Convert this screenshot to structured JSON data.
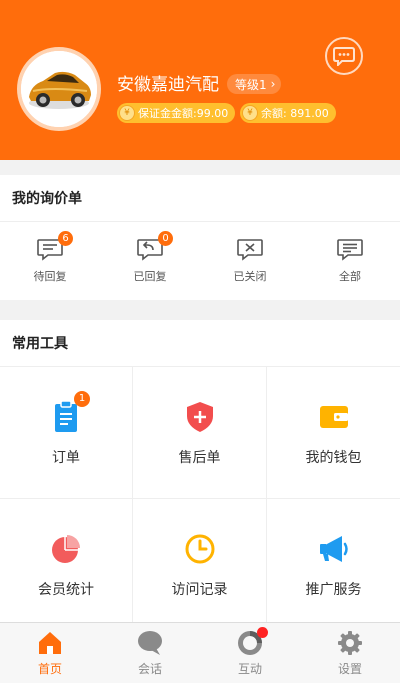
{
  "profile": {
    "shop_name": "安徽嘉迪汽配",
    "level_label": "等级1",
    "deposit_label": "保证金金额:99.00",
    "balance_label": "余额: 891.00",
    "coin_glyph": "¥"
  },
  "inquiry": {
    "title": "我的询价单",
    "items": [
      {
        "label": "待回复",
        "badge": "6"
      },
      {
        "label": "已回复",
        "badge": "0"
      },
      {
        "label": "已关闭"
      },
      {
        "label": "全部"
      }
    ]
  },
  "tools": {
    "title": "常用工具",
    "items": [
      {
        "label": "订单",
        "badge": "1",
        "icon": "clipboard-icon",
        "color": "#1e9bf0"
      },
      {
        "label": "售后单",
        "icon": "shield-plus-icon",
        "color": "#f24d4d"
      },
      {
        "label": "我的钱包",
        "icon": "wallet-icon",
        "color": "#ffb300"
      },
      {
        "label": "会员统计",
        "icon": "pie-chart-icon",
        "color": "#f25c5c"
      },
      {
        "label": "访问记录",
        "icon": "clock-icon",
        "color": "#ffb300"
      },
      {
        "label": "推广服务",
        "icon": "megaphone-icon",
        "color": "#1e9bf0"
      }
    ]
  },
  "tabbar": {
    "items": [
      {
        "label": "首页",
        "active": true
      },
      {
        "label": "会话"
      },
      {
        "label": "互动"
      },
      {
        "label": "设置"
      }
    ]
  },
  "colors": {
    "brand": "#ff6d0c",
    "badge": "#ff6d0c"
  }
}
